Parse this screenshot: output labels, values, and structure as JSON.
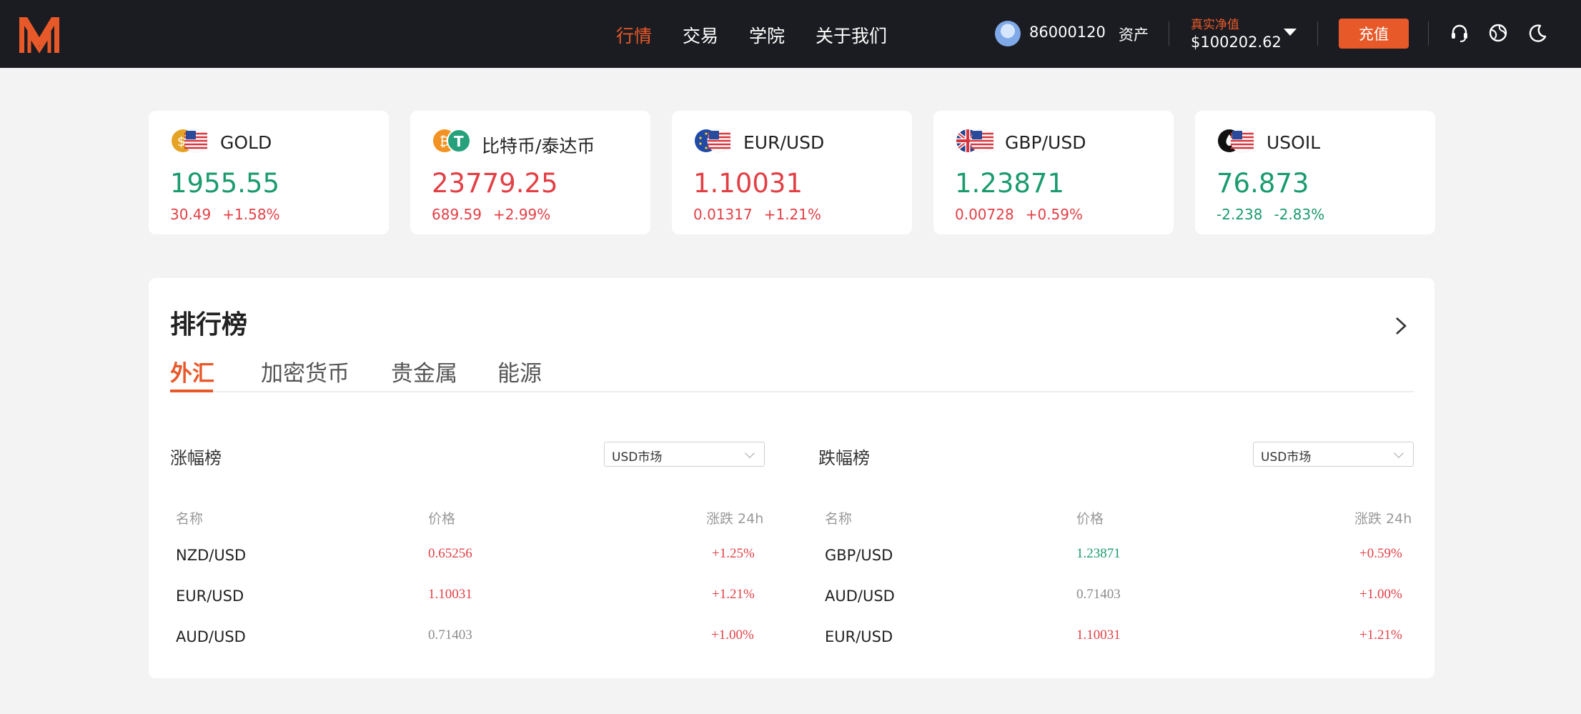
{
  "header": {
    "nav": [
      "行情",
      "交易",
      "学院",
      "关于我们"
    ],
    "user_id": "86000120",
    "assets_label": "资产",
    "net_value_label": "真实净值",
    "net_value": "$100202.62",
    "deposit_label": "充值",
    "icons": [
      "support-icon",
      "globe-icon",
      "moon-icon"
    ]
  },
  "tickers": [
    {
      "name": "GOLD",
      "price": "1955.55",
      "change": "30.49",
      "change_pct": "+1.58%",
      "direction": "down"
    },
    {
      "name": "比特币/泰达币",
      "price": "23779.25",
      "change": "689.59",
      "change_pct": "+2.99%",
      "direction": "up"
    },
    {
      "name": "EUR/USD",
      "price": "1.10031",
      "change": "0.01317",
      "change_pct": "+1.21%",
      "direction": "up"
    },
    {
      "name": "GBP/USD",
      "price": "1.23871",
      "change": "0.00728",
      "change_pct": "+0.59%",
      "direction": "down"
    },
    {
      "name": "USOIL",
      "price": "76.873",
      "change": "-2.238",
      "change_pct": "-2.83%",
      "direction": "down"
    }
  ],
  "ranking": {
    "title": "排行榜",
    "tabs": [
      "外汇",
      "加密货币",
      "贵金属",
      "能源"
    ],
    "gainers": {
      "title": "涨幅榜",
      "market": "USD市场",
      "columns": [
        "名称",
        "价格",
        "涨跌 24h"
      ],
      "rows": [
        {
          "name": "NZD/USD",
          "price": "0.65256",
          "change": "+1.25%",
          "price_color": "up"
        },
        {
          "name": "EUR/USD",
          "price": "1.10031",
          "change": "+1.21%",
          "price_color": "up"
        },
        {
          "name": "AUD/USD",
          "price": "0.71403",
          "change": "+1.00%",
          "price_color": "gray"
        }
      ]
    },
    "losers": {
      "title": "跌幅榜",
      "market": "USD市场",
      "columns": [
        "名称",
        "价格",
        "涨跌 24h"
      ],
      "rows": [
        {
          "name": "GBP/USD",
          "price": "1.23871",
          "change": "+0.59%",
          "price_color": "down"
        },
        {
          "name": "AUD/USD",
          "price": "0.71403",
          "change": "+1.00%",
          "price_color": "gray"
        },
        {
          "name": "EUR/USD",
          "price": "1.10031",
          "change": "+1.21%",
          "price_color": "up"
        }
      ]
    }
  },
  "colors": {
    "accent": "#e8592a",
    "up": "#e23f45",
    "down": "#1a9b6d",
    "header_bg": "#1b1c21"
  }
}
